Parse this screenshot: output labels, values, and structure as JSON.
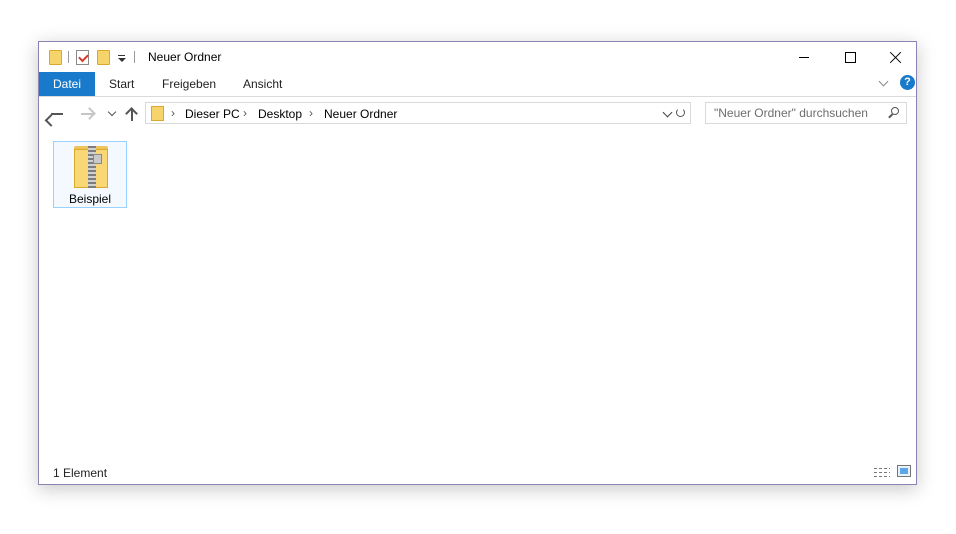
{
  "window": {
    "title": "Neuer Ordner",
    "accent_color": "#1979ca"
  },
  "ribbon": {
    "tabs": [
      {
        "label": "Datei",
        "active": true
      },
      {
        "label": "Start"
      },
      {
        "label": "Freigeben"
      },
      {
        "label": "Ansicht"
      }
    ],
    "help_label": "?"
  },
  "navigation": {
    "breadcrumb": [
      "Dieser PC",
      "Desktop",
      "Neuer Ordner"
    ],
    "separator": "›",
    "search_placeholder": "\"Neuer Ordner\" durchsuchen"
  },
  "content": {
    "items": [
      {
        "name": "Beispiel",
        "icon": "zip-folder-icon",
        "selected": true
      }
    ]
  },
  "status": {
    "item_count": "1 Element"
  }
}
